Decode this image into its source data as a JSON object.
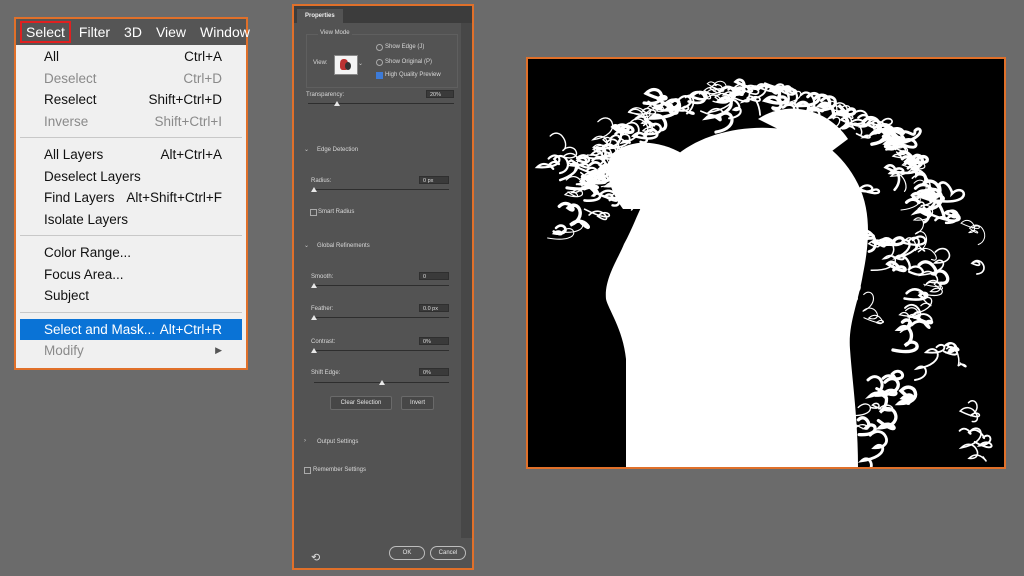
{
  "menubar": {
    "items": [
      {
        "label": "Select",
        "active": true
      },
      {
        "label": "Filter"
      },
      {
        "label": "3D"
      },
      {
        "label": "View"
      },
      {
        "label": "Window"
      }
    ]
  },
  "select_menu": {
    "groups": [
      [
        {
          "label": "All",
          "shortcut": "Ctrl+A",
          "enabled": true
        },
        {
          "label": "Deselect",
          "shortcut": "Ctrl+D",
          "enabled": false
        },
        {
          "label": "Reselect",
          "shortcut": "Shift+Ctrl+D",
          "enabled": true
        },
        {
          "label": "Inverse",
          "shortcut": "Shift+Ctrl+I",
          "enabled": false
        }
      ],
      [
        {
          "label": "All Layers",
          "shortcut": "Alt+Ctrl+A",
          "enabled": true
        },
        {
          "label": "Deselect Layers",
          "shortcut": "",
          "enabled": true
        },
        {
          "label": "Find Layers",
          "shortcut": "Alt+Shift+Ctrl+F",
          "enabled": true
        },
        {
          "label": "Isolate Layers",
          "shortcut": "",
          "enabled": true
        }
      ],
      [
        {
          "label": "Color Range...",
          "shortcut": "",
          "enabled": true
        },
        {
          "label": "Focus Area...",
          "shortcut": "",
          "enabled": true
        },
        {
          "label": "Subject",
          "shortcut": "",
          "enabled": true
        }
      ],
      [
        {
          "label": "Select and Mask...",
          "shortcut": "Alt+Ctrl+R",
          "enabled": true,
          "highlighted": true
        },
        {
          "label": "Modify",
          "shortcut": "",
          "enabled": false,
          "submenu": true
        }
      ]
    ]
  },
  "properties": {
    "tab_label": "Properties",
    "view_mode": {
      "section_label": "View Mode",
      "view_label": "View:",
      "show_edge": "Show Edge (J)",
      "show_original": "Show Original (P)",
      "high_quality": "High Quality Preview",
      "high_quality_checked": true
    },
    "transparency": {
      "label": "Transparency:",
      "value": "20%",
      "level": 0.2
    },
    "edge_detection": {
      "section_label": "Edge Detection",
      "radius_label": "Radius:",
      "radius_value": "0 px",
      "radius_level": 0,
      "smart_radius_label": "Smart Radius"
    },
    "global_refinements": {
      "section_label": "Global Refinements",
      "smooth_label": "Smooth:",
      "smooth_value": "0",
      "smooth_level": 0,
      "feather_label": "Feather:",
      "feather_value": "0.0 px",
      "feather_level": 0,
      "contrast_label": "Contrast:",
      "contrast_value": "0%",
      "contrast_level": 0,
      "shift_edge_label": "Shift Edge:",
      "shift_edge_value": "0%",
      "shift_edge_level": 0.5
    },
    "clear_selection_label": "Clear Selection",
    "invert_label": "Invert",
    "output_settings_label": "Output Settings",
    "remember_settings_label": "Remember Settings",
    "ok_label": "OK",
    "cancel_label": "Cancel",
    "reset_icon": "reset-icon"
  },
  "colors": {
    "accent_border": "#e0702a",
    "highlight": "#0a73d6",
    "active_menu_border": "#e02020"
  }
}
